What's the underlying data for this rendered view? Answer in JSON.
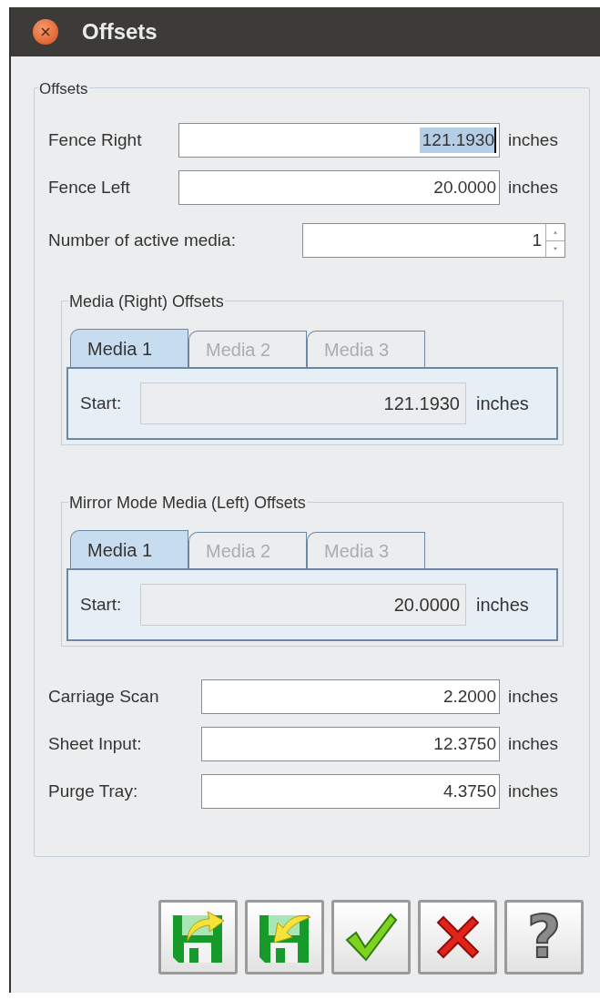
{
  "window": {
    "title": "Offsets"
  },
  "offsets_group": {
    "title": "Offsets",
    "fence_fields": [
      {
        "label": "Fence Right",
        "value": "121.1930",
        "unit": "inches",
        "text_selected": true
      },
      {
        "label": "Fence Left",
        "value": "20.0000",
        "unit": "inches",
        "text_selected": false
      }
    ],
    "active_media": {
      "label": "Number of active media:",
      "value": "1"
    },
    "media_groups": [
      {
        "title": "Media (Right) Offsets",
        "tabs": [
          {
            "label": "Media 1",
            "selected": true,
            "disabled": false
          },
          {
            "label": "Media 2",
            "selected": false,
            "disabled": true
          },
          {
            "label": "Media 3",
            "selected": false,
            "disabled": true
          }
        ],
        "start": {
          "label": "Start:",
          "value": "121.1930",
          "unit": "inches",
          "readonly": true
        }
      },
      {
        "title": "Mirror Mode Media (Left) Offsets",
        "tabs": [
          {
            "label": "Media 1",
            "selected": true,
            "disabled": false
          },
          {
            "label": "Media 2",
            "selected": false,
            "disabled": true
          },
          {
            "label": "Media 3",
            "selected": false,
            "disabled": true
          }
        ],
        "start": {
          "label": "Start:",
          "value": "20.0000",
          "unit": "inches",
          "readonly": true
        }
      }
    ],
    "other_fields": [
      {
        "label": "Carriage Scan",
        "value": "2.2000",
        "unit": "inches"
      },
      {
        "label": "Sheet Input:",
        "value": "12.3750",
        "unit": "inches"
      },
      {
        "label": "Purge Tray:",
        "value": "4.3750",
        "unit": "inches"
      }
    ]
  },
  "buttons": [
    {
      "kind": "export"
    },
    {
      "kind": "import"
    },
    {
      "kind": "ok"
    },
    {
      "kind": "cancel"
    },
    {
      "kind": "help",
      "label": "?"
    }
  ]
}
